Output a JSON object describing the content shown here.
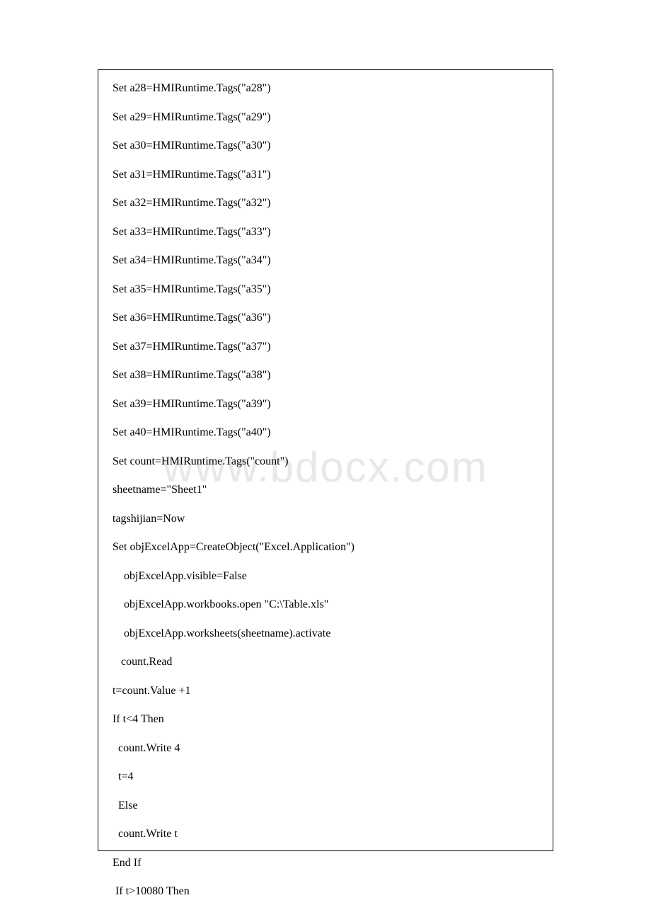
{
  "watermark": "www.bdocx.com",
  "lines": [
    "Set a28=HMIRuntime.Tags(\"a28\")",
    "Set a29=HMIRuntime.Tags(\"a29\")",
    "Set a30=HMIRuntime.Tags(\"a30\")",
    "Set a31=HMIRuntime.Tags(\"a31\")",
    "Set a32=HMIRuntime.Tags(\"a32\")",
    "Set a33=HMIRuntime.Tags(\"a33\")",
    "Set a34=HMIRuntime.Tags(\"a34\")",
    "Set a35=HMIRuntime.Tags(\"a35\")",
    "Set a36=HMIRuntime.Tags(\"a36\")",
    "Set a37=HMIRuntime.Tags(\"a37\")",
    "Set a38=HMIRuntime.Tags(\"a38\")",
    "Set a39=HMIRuntime.Tags(\"a39\")",
    "Set a40=HMIRuntime.Tags(\"a40\")",
    "Set count=HMIRuntime.Tags(\"count\")",
    "sheetname=\"Sheet1\"",
    "tagshijian=Now",
    "Set objExcelApp=CreateObject(\"Excel.Application\")",
    "    objExcelApp.visible=False",
    "    objExcelApp.workbooks.open \"C:\\Table.xls\"",
    "    objExcelApp.worksheets(sheetname).activate",
    "   count.Read",
    "t=count.Value +1",
    "If t<4 Then",
    "  count.Write 4",
    "  t=4",
    "  Else",
    "  count.Write t",
    "End If",
    " If t>10080 Then"
  ]
}
